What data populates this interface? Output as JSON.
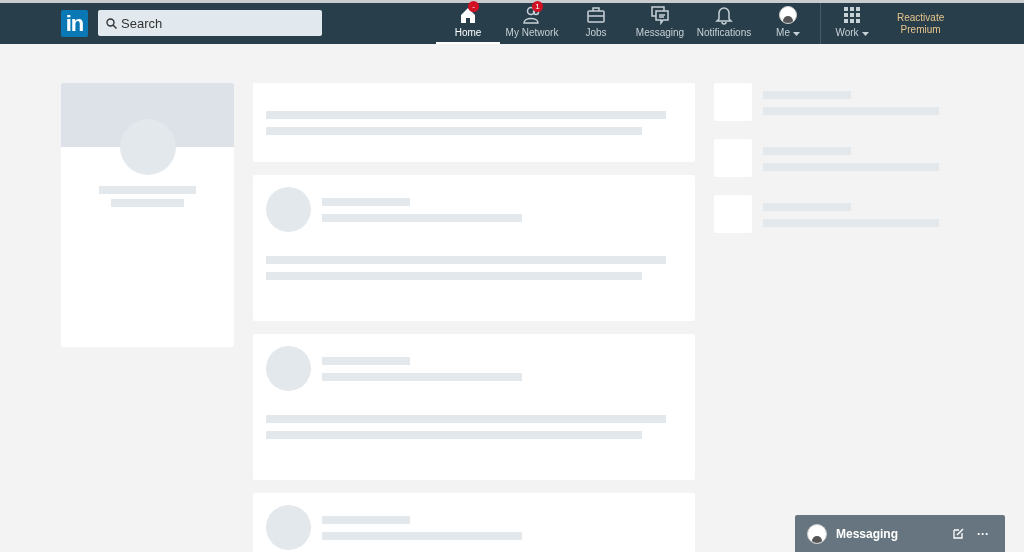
{
  "nav": {
    "logo": "in",
    "search": {
      "placeholder": "Search"
    },
    "items": [
      {
        "kind": "home",
        "label": "Home",
        "selected": true,
        "badge": "-"
      },
      {
        "kind": "network",
        "label": "My Network",
        "selected": false,
        "badge": "1"
      },
      {
        "kind": "jobs",
        "label": "Jobs",
        "selected": false
      },
      {
        "kind": "messaging",
        "label": "Messaging",
        "selected": false
      },
      {
        "kind": "notifications",
        "label": "Notifications",
        "selected": false
      },
      {
        "kind": "me",
        "label": "Me",
        "selected": false,
        "dropdown": true
      }
    ],
    "work": {
      "label": "Work",
      "dropdown": true
    },
    "premium": [
      "Reactivate",
      "Premium"
    ]
  },
  "feed": [
    {
      "kind": "lines"
    },
    {
      "kind": "post"
    },
    {
      "kind": "post"
    },
    {
      "kind": "post"
    }
  ],
  "right_rail": [
    {
      "kind": "skeleton"
    },
    {
      "kind": "skeleton"
    },
    {
      "kind": "skeleton"
    }
  ],
  "messaging_bar": {
    "title": "Messaging",
    "more": "···"
  }
}
